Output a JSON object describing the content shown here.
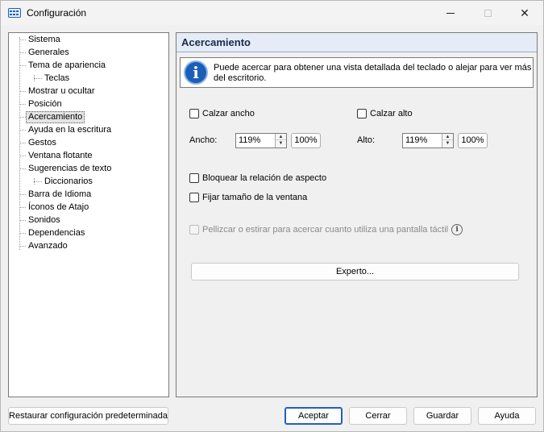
{
  "window": {
    "title": "Configuración"
  },
  "tree": {
    "items": [
      {
        "label": "Sistema",
        "level": 0
      },
      {
        "label": "Generales",
        "level": 0
      },
      {
        "label": "Tema de apariencia",
        "level": 0
      },
      {
        "label": "Teclas",
        "level": 1
      },
      {
        "label": "Mostrar u ocultar",
        "level": 0
      },
      {
        "label": "Posición",
        "level": 0
      },
      {
        "label": "Acercamiento",
        "level": 0,
        "selected": true
      },
      {
        "label": "Ayuda en la escritura",
        "level": 0
      },
      {
        "label": "Gestos",
        "level": 0
      },
      {
        "label": "Ventana flotante",
        "level": 0
      },
      {
        "label": "Sugerencias de texto",
        "level": 0
      },
      {
        "label": "Diccionarios",
        "level": 1
      },
      {
        "label": "Barra de Idioma",
        "level": 0
      },
      {
        "label": "Íconos de Atajo",
        "level": 0
      },
      {
        "label": "Sonidos",
        "level": 0
      },
      {
        "label": "Dependencias",
        "level": 0
      },
      {
        "label": "Avanzado",
        "level": 0
      }
    ]
  },
  "panel": {
    "title": "Acercamiento",
    "info_text": "Puede acercar para obtener una vista detallada del teclado o alejar para ver más del escritorio.",
    "fit_width_label": "Calzar ancho",
    "fit_height_label": "Calzar alto",
    "width_label": "Ancho:",
    "width_value": "119%",
    "width_reset": "100%",
    "height_label": "Alto:",
    "height_value": "119%",
    "height_reset": "100%",
    "lock_ratio_label": "Bloquear la relación de aspecto",
    "fix_size_label": "Fijar tamaño de la ventana",
    "pinch_label": "Pellizcar o estirar para acercar cuanto utiliza una pantalla táctil",
    "expert_button": "Experto..."
  },
  "footer": {
    "restore_button": "Restaurar configuración predeterminada",
    "accept_button": "Aceptar",
    "close_button": "Cerrar",
    "save_button": "Guardar",
    "help_button": "Ayuda"
  }
}
